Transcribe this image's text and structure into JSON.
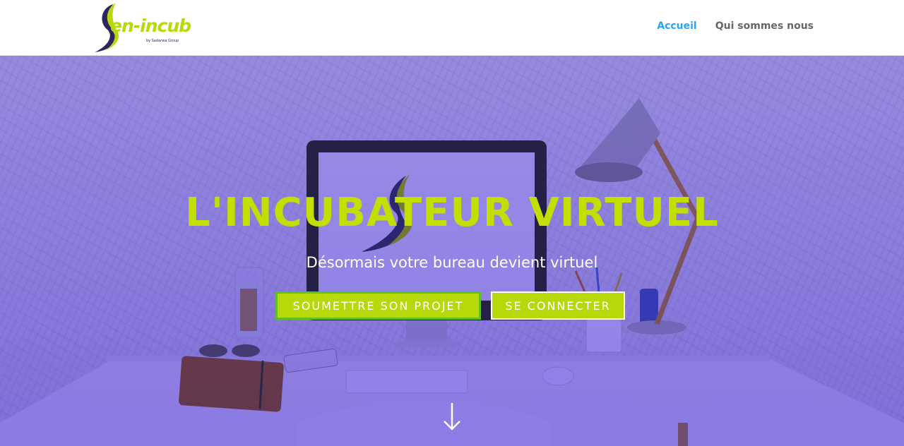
{
  "header": {
    "logo": {
      "wordmark": "en-incub",
      "initial": "S",
      "tagline": "by Sadarwa Group",
      "accent_color": "#b8d80a",
      "dark_color": "#2a2660"
    },
    "nav": [
      {
        "label": "Accueil",
        "active": true
      },
      {
        "label": "Qui sommes nous",
        "active": false
      }
    ],
    "active_color": "#2ea3f2"
  },
  "hero": {
    "title": "L'INCUBATEUR VIRTUEL",
    "subtitle": "Désormais votre bureau devient virtuel",
    "buttons": {
      "submit_label": "SOUMETTRE SON PROJET",
      "login_label": "SE CONNECTER"
    },
    "overlay_color": "#7a63e0",
    "title_color": "#c3df00",
    "scroll_icon": "arrow-down-icon"
  }
}
